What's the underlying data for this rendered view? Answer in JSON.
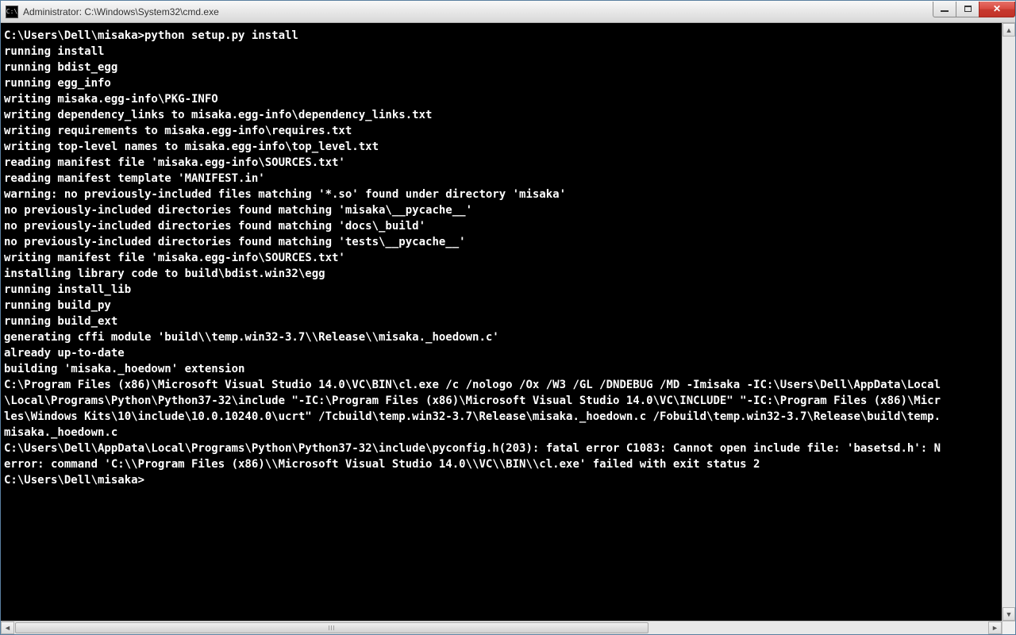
{
  "window": {
    "icon_label": "C:\\",
    "title": "Administrator: C:\\Windows\\System32\\cmd.exe"
  },
  "terminal": {
    "lines": [
      "",
      "C:\\Users\\Dell\\misaka>python setup.py install",
      "running install",
      "running bdist_egg",
      "running egg_info",
      "writing misaka.egg-info\\PKG-INFO",
      "writing dependency_links to misaka.egg-info\\dependency_links.txt",
      "writing requirements to misaka.egg-info\\requires.txt",
      "writing top-level names to misaka.egg-info\\top_level.txt",
      "reading manifest file 'misaka.egg-info\\SOURCES.txt'",
      "reading manifest template 'MANIFEST.in'",
      "warning: no previously-included files matching '*.so' found under directory 'misaka'",
      "no previously-included directories found matching 'misaka\\__pycache__'",
      "no previously-included directories found matching 'docs\\_build'",
      "no previously-included directories found matching 'tests\\__pycache__'",
      "writing manifest file 'misaka.egg-info\\SOURCES.txt'",
      "installing library code to build\\bdist.win32\\egg",
      "running install_lib",
      "running build_py",
      "running build_ext",
      "generating cffi module 'build\\\\temp.win32-3.7\\\\Release\\\\misaka._hoedown.c'",
      "already up-to-date",
      "building 'misaka._hoedown' extension",
      "C:\\Program Files (x86)\\Microsoft Visual Studio 14.0\\VC\\BIN\\cl.exe /c /nologo /Ox /W3 /GL /DNDEBUG /MD -Imisaka -IC:\\Users\\Dell\\AppData\\Local",
      "\\Local\\Programs\\Python\\Python37-32\\include \"-IC:\\Program Files (x86)\\Microsoft Visual Studio 14.0\\VC\\INCLUDE\" \"-IC:\\Program Files (x86)\\Micr",
      "les\\Windows Kits\\10\\include\\10.0.10240.0\\ucrt\" /Tcbuild\\temp.win32-3.7\\Release\\misaka._hoedown.c /Fobuild\\temp.win32-3.7\\Release\\build\\temp.",
      "misaka._hoedown.c",
      "C:\\Users\\Dell\\AppData\\Local\\Programs\\Python\\Python37-32\\include\\pyconfig.h(203): fatal error C1083: Cannot open include file: 'basetsd.h': N",
      "error: command 'C:\\\\Program Files (x86)\\\\Microsoft Visual Studio 14.0\\\\VC\\\\BIN\\\\cl.exe' failed with exit status 2",
      "",
      "C:\\Users\\Dell\\misaka>"
    ]
  }
}
